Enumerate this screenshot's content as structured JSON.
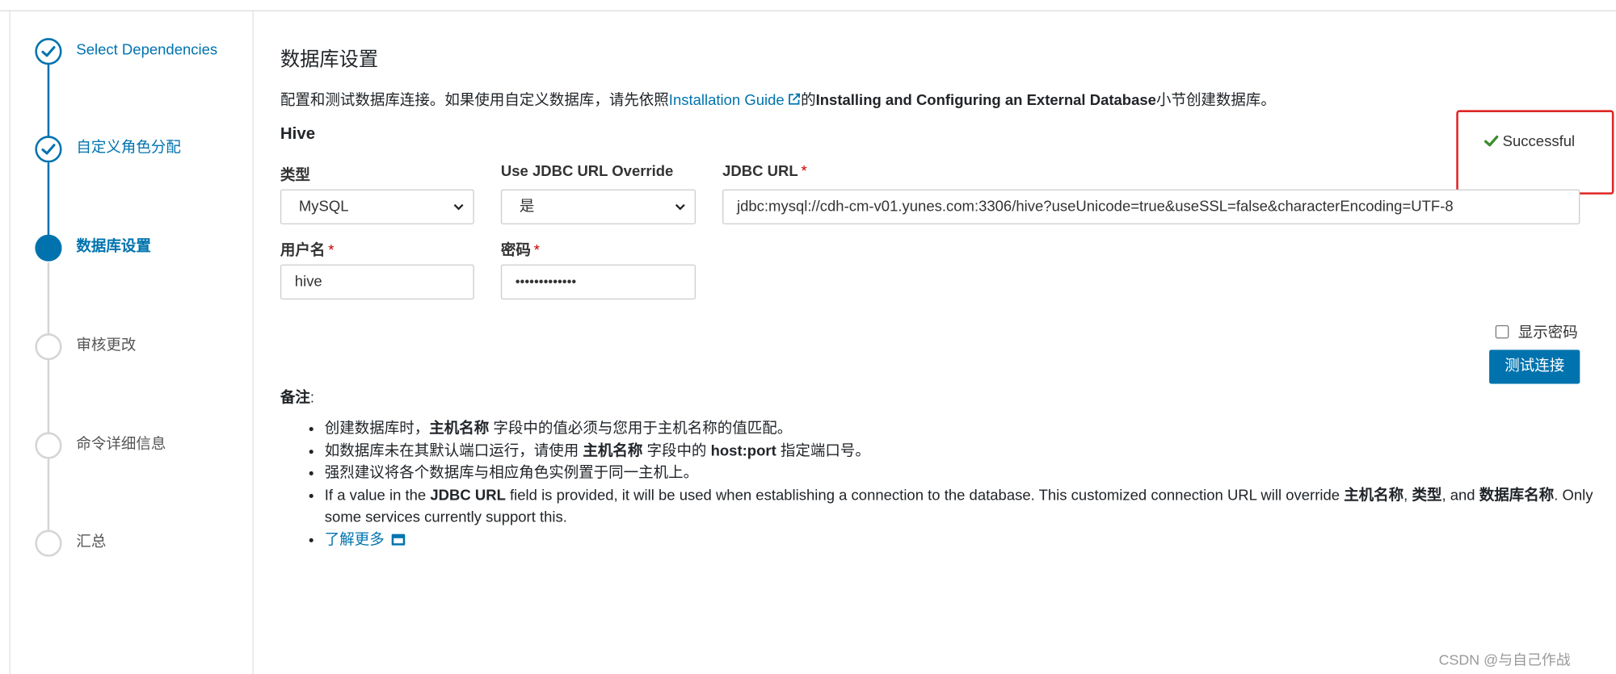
{
  "steps": [
    {
      "label": "Select Dependencies",
      "state": "done"
    },
    {
      "label": "自定义角色分配",
      "state": "done"
    },
    {
      "label": "数据库设置",
      "state": "active"
    },
    {
      "label": "审核更改",
      "state": "pending"
    },
    {
      "label": "命令详细信息",
      "state": "pending"
    },
    {
      "label": "汇总",
      "state": "pending"
    }
  ],
  "main": {
    "title": "数据库设置",
    "intro": {
      "prefix": "配置和测试数据库连接。如果使用自定义数据库，请先依照",
      "link": "Installation Guide",
      "middle": "的",
      "bold": "Installing and Configuring an External Database",
      "suffix": "小节创建数据库。"
    },
    "section_title": "Hive",
    "status": "Successful",
    "fields": {
      "type_label": "类型",
      "type_value": "MySQL",
      "override_label": "Use JDBC URL Override",
      "override_value": "是",
      "jdbc_label": "JDBC URL",
      "jdbc_value": "jdbc:mysql://cdh-cm-v01.yunes.com:3306/hive?useUnicode=true&useSSL=false&characterEncoding=UTF-8",
      "user_label": "用户名",
      "user_value": "hive",
      "password_label": "密码",
      "password_value": "•••••••••••••",
      "required_mark": "*"
    },
    "show_password_label": "显示密码",
    "test_button": "测试连接",
    "notes_title": "备注",
    "notes_colon": ":",
    "notes": {
      "n1": {
        "a": "创建数据库时，",
        "b": "主机名称",
        "c": " 字段中的值必须与您用于主机名称的值匹配。"
      },
      "n2": {
        "a": "如数据库未在其默认端口运行，请使用 ",
        "b": "主机名称",
        "c": " 字段中的 ",
        "d": "host:port",
        "e": " 指定端口号。"
      },
      "n3": {
        "a": "强烈建议将各个数据库与相应角色实例置于同一主机上。"
      },
      "n4": {
        "a": "If a value in the ",
        "b": "JDBC URL",
        "c": " field is provided, it will be used when establishing a connection to the database. This customized connection URL will override ",
        "d": "主机名称",
        "e": ", ",
        "f": "类型",
        "g": ", and ",
        "h": "数据库名称",
        "i": ". Only some services currently support this."
      },
      "learn_more": "了解更多"
    }
  },
  "watermark": "CSDN @与自己作战",
  "colors": {
    "accent": "#0073ae",
    "success": "#3c8d2f",
    "highlight": "#e02424"
  }
}
